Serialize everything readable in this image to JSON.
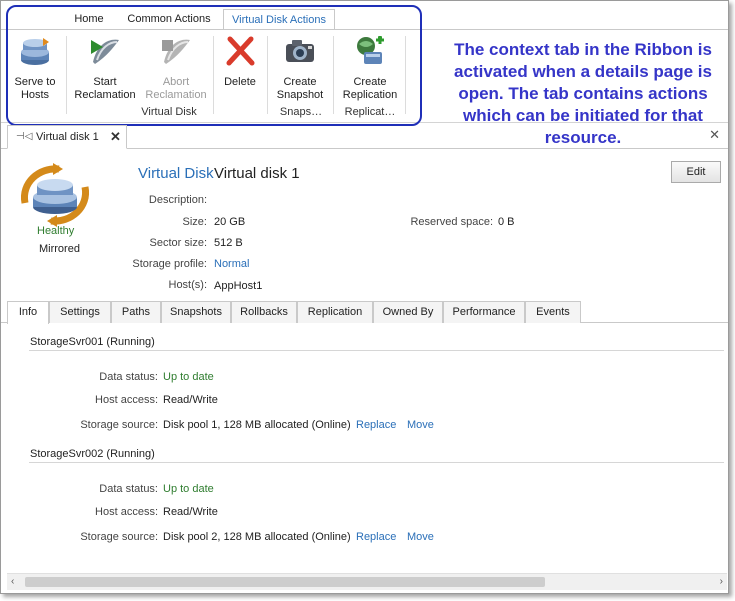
{
  "ribbon": {
    "tabs": [
      {
        "label": "Home"
      },
      {
        "label": "Common Actions"
      },
      {
        "label": "Virtual Disk Actions"
      }
    ],
    "buttons": {
      "serve_to_hosts": "Serve to\nHosts",
      "start_reclamation": "Start\nReclamation",
      "abort_reclamation": "Abort\nReclamation",
      "delete": "Delete",
      "create_snapshot": "Create\nSnapshot",
      "create_replication": "Create\nReplication"
    },
    "groups": {
      "virtual_disk": "Virtual Disk",
      "snapshots": "Snaps…",
      "replication": "Replicat…"
    }
  },
  "annotation": "The context tab in the Ribbon is activated when a details page is open. The tab contains actions which can be initiated for that resource.",
  "document_tab": {
    "label": "Virtual disk 1"
  },
  "details": {
    "status_health": "Healthy",
    "status_mirror": "Mirrored",
    "type_label": "Virtual Disk",
    "name": "Virtual disk 1",
    "edit_label": "Edit",
    "fields": {
      "description_label": "Description:",
      "description_value": "",
      "size_label": "Size:",
      "size_value": "20 GB",
      "reserved_label": "Reserved space:",
      "reserved_value": "0 B",
      "sector_label": "Sector size:",
      "sector_value": "512 B",
      "profile_label": "Storage profile:",
      "profile_value": "Normal",
      "hosts_label": "Host(s):",
      "hosts_value": "AppHost1"
    }
  },
  "subtabs": [
    {
      "label": "Info"
    },
    {
      "label": "Settings"
    },
    {
      "label": "Paths"
    },
    {
      "label": "Snapshots"
    },
    {
      "label": "Rollbacks"
    },
    {
      "label": "Replication"
    },
    {
      "label": "Owned By"
    },
    {
      "label": "Performance"
    },
    {
      "label": "Events"
    }
  ],
  "servers": [
    {
      "header": "StorageSvr001 (Running)",
      "data_status_label": "Data status:",
      "data_status": "Up to date",
      "host_access_label": "Host access:",
      "host_access": "Read/Write",
      "storage_source_label": "Storage source:",
      "storage_source": "Disk pool 1, 128 MB allocated (Online)",
      "replace": "Replace",
      "move": "Move"
    },
    {
      "header": "StorageSvr002 (Running)",
      "data_status_label": "Data status:",
      "data_status": "Up to date",
      "host_access_label": "Host access:",
      "host_access": "Read/Write",
      "storage_source_label": "Storage source:",
      "storage_source": "Disk pool 2, 128 MB allocated (Online)",
      "replace": "Replace",
      "move": "Move"
    }
  ],
  "scroll": {
    "left_arrow": "‹",
    "right_arrow": "›"
  },
  "colors": {
    "accent": "#2a6fb8",
    "ok_green": "#2f7d2f",
    "annotation": "#3535c8"
  }
}
